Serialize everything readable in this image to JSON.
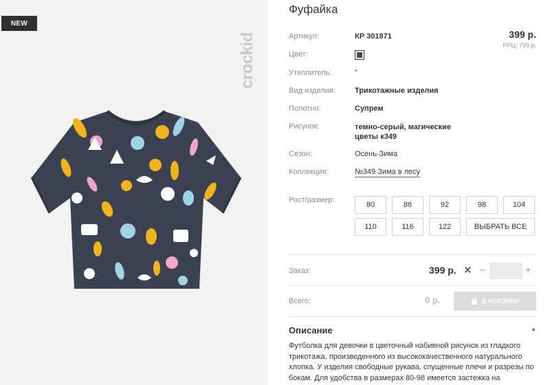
{
  "image": {
    "badge": "NEW",
    "brand": "crockid"
  },
  "product": {
    "title": "Фуфайка",
    "price": "399 р.",
    "rrc": "РРЦ: 799 р."
  },
  "specs": [
    {
      "label": "Артикул:",
      "value": "КР 301871"
    },
    {
      "label": "Цвет:",
      "value": ""
    },
    {
      "label": "Утеплитель:",
      "value": "\""
    },
    {
      "label": "Вид изделия:",
      "value": "Трикотажные изделия"
    },
    {
      "label": "Полотно:",
      "value": "Супрем"
    },
    {
      "label": "Рисунок:",
      "value": "темно-серый, магические цветы к349"
    },
    {
      "label": "Сезон:",
      "value": "Осень-Зима"
    },
    {
      "label": "Коллекция:",
      "value": "№349 Зима в лесу"
    }
  ],
  "sizes": {
    "label": "Рост/размер:",
    "options": [
      "80",
      "86",
      "92",
      "98",
      "104",
      "110",
      "116",
      "122"
    ],
    "select_all": "ВЫБРАТЬ ВСЕ"
  },
  "order": {
    "label": "Заказ:",
    "price": "399 р.",
    "remove_icon": "close-icon",
    "minus": "–",
    "plus": "+",
    "quantity": ""
  },
  "total": {
    "label": "Всего:",
    "value": "0 р.",
    "cart_button": "В КОРЗИНУ"
  },
  "description": {
    "title": "Описание",
    "toggle": "▲",
    "text": "Футболка для девочки в цветочный набивной рисунок из гладкого трикотажа, произведенного из высококачественного натурального хлопка. У изделия свободные рукава, спущенные плечи и разрезы по бокам. Для удобства в размерах 80-98 имеется застежка на"
  },
  "colors": {
    "shirt": "#3b4150",
    "swatch": "#4a4a4a",
    "accent_yellow": "#f2b41c",
    "pink": "#f0a8c8",
    "light_blue": "#9fd3e6"
  }
}
